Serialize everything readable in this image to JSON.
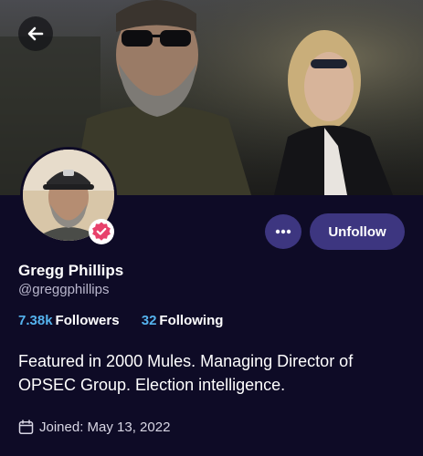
{
  "header": {
    "back_icon": "arrow-left-icon"
  },
  "profile": {
    "display_name": "Gregg Phillips",
    "handle": "@greggphillips",
    "verified_icon": "verified-check-badge-icon",
    "bio": "Featured in 2000 Mules. Managing Director of OPSEC Group. Election intelligence.",
    "joined": "Joined: May 13, 2022"
  },
  "stats": {
    "followers_count": "7.38k",
    "followers_label": "Followers",
    "following_count": "32",
    "following_label": "Following"
  },
  "actions": {
    "more_icon": "ellipsis-icon",
    "unfollow_label": "Unfollow"
  },
  "colors": {
    "background": "#0e0b26",
    "button_bg": "#3d3680",
    "stat_accent": "#55b3ee",
    "badge_pink": "#e8416c"
  }
}
